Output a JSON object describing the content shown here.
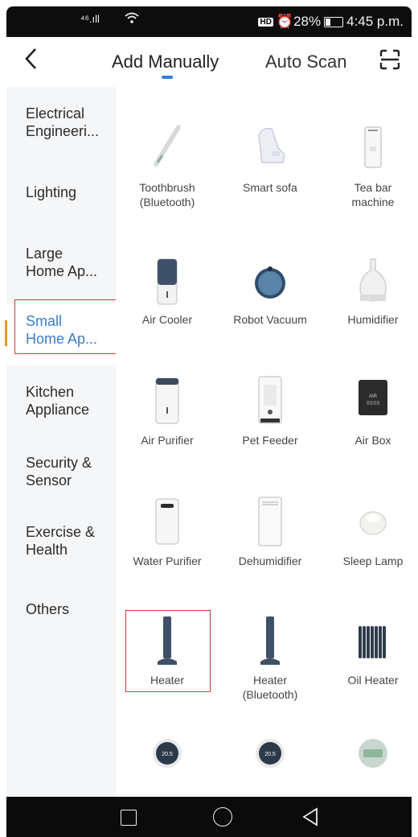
{
  "status_bar": {
    "signal": "⁴⁶.ıll",
    "hd": "HD",
    "battery": "⏰28%",
    "time": "4:45 p.m."
  },
  "header": {
    "back_icon": "back-chevron-icon",
    "tab_manual": "Add Manually",
    "tab_scan": "Auto Scan",
    "scan_icon": "scan-frame-icon",
    "accent": "#2f7de1"
  },
  "categories": [
    {
      "label": "Electrical\nEngineeri..."
    },
    {
      "label": "Lighting"
    },
    {
      "label": "Large\nHome Ap..."
    },
    {
      "label": "Small\nHome Ap...",
      "active": true
    },
    {
      "label": "Kitchen\nAppliance"
    },
    {
      "label": "Security &\nSensor"
    },
    {
      "label": "Exercise &\nHealth"
    },
    {
      "label": "Others"
    }
  ],
  "devices": [
    {
      "label": "Toothbrush\n(Bluetooth)",
      "icon": "toothbrush-icon"
    },
    {
      "label": "Smart sofa",
      "icon": "sofa-icon"
    },
    {
      "label": "Tea bar\nmachine",
      "icon": "tea-bar-icon"
    },
    {
      "label": "Air Cooler",
      "icon": "air-cooler-icon"
    },
    {
      "label": "Robot Vacuum",
      "icon": "robot-vacuum-icon"
    },
    {
      "label": "Humidifier",
      "icon": "humidifier-icon"
    },
    {
      "label": "Air Purifier",
      "icon": "air-purifier-icon"
    },
    {
      "label": "Pet Feeder",
      "icon": "pet-feeder-icon"
    },
    {
      "label": "Air Box",
      "icon": "air-box-icon"
    },
    {
      "label": "Water Purifier",
      "icon": "water-purifier-icon"
    },
    {
      "label": "Dehumidifier",
      "icon": "dehumidifier-icon"
    },
    {
      "label": "Sleep Lamp",
      "icon": "sleep-lamp-icon"
    },
    {
      "label": "Heater",
      "icon": "heater-icon",
      "selected": true
    },
    {
      "label": "Heater\n(Bluetooth)",
      "icon": "heater-icon"
    },
    {
      "label": "Oil Heater",
      "icon": "oil-heater-icon"
    },
    {
      "label": "",
      "icon": "thermostat-icon",
      "display": "20.5"
    },
    {
      "label": "",
      "icon": "thermostat-icon",
      "display": "20.5"
    },
    {
      "label": "",
      "icon": "trv-icon"
    }
  ],
  "nav_bar": {
    "recent_icon": "recent-apps-square-icon",
    "home_icon": "home-circle-icon",
    "back_icon": "back-triangle-icon"
  }
}
